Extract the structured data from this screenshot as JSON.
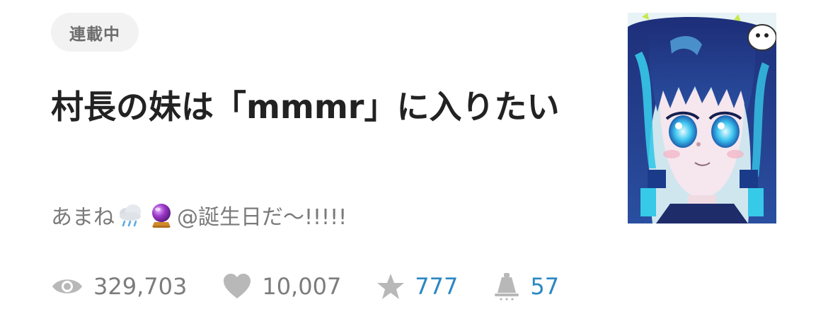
{
  "badge": {
    "label": "連載中"
  },
  "work": {
    "title": "村長の妹は「mmmr」に入りたい",
    "author_prefix": "あまね",
    "author_suffix": "@誕生日だ〜!!!!!",
    "author_emojis": [
      "cloud-rain-icon",
      "crystal-ball-icon"
    ]
  },
  "stats": {
    "views": "329,703",
    "likes": "10,007",
    "stars": "777",
    "comments": "57"
  },
  "colors": {
    "count_gray": "#7c7c7c",
    "count_blue": "#2a88c2",
    "icon_gray": "#b8b8b8",
    "badge_bg": "#f2f2f2"
  },
  "thumbnail": {
    "subject": "anime-girl-illustration"
  }
}
